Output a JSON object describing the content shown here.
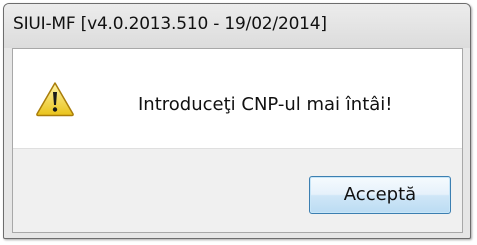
{
  "window": {
    "title": "SIUI-MF [v4.0.2013.510 - 19/02/2014]"
  },
  "dialog": {
    "icon": "warning-icon",
    "message": "Introduceţi CNP-ul mai întâi!",
    "accept_label": "Acceptă"
  },
  "colors": {
    "warning_yellow": "#f5d93a",
    "button_border": "#3c7fb1"
  }
}
